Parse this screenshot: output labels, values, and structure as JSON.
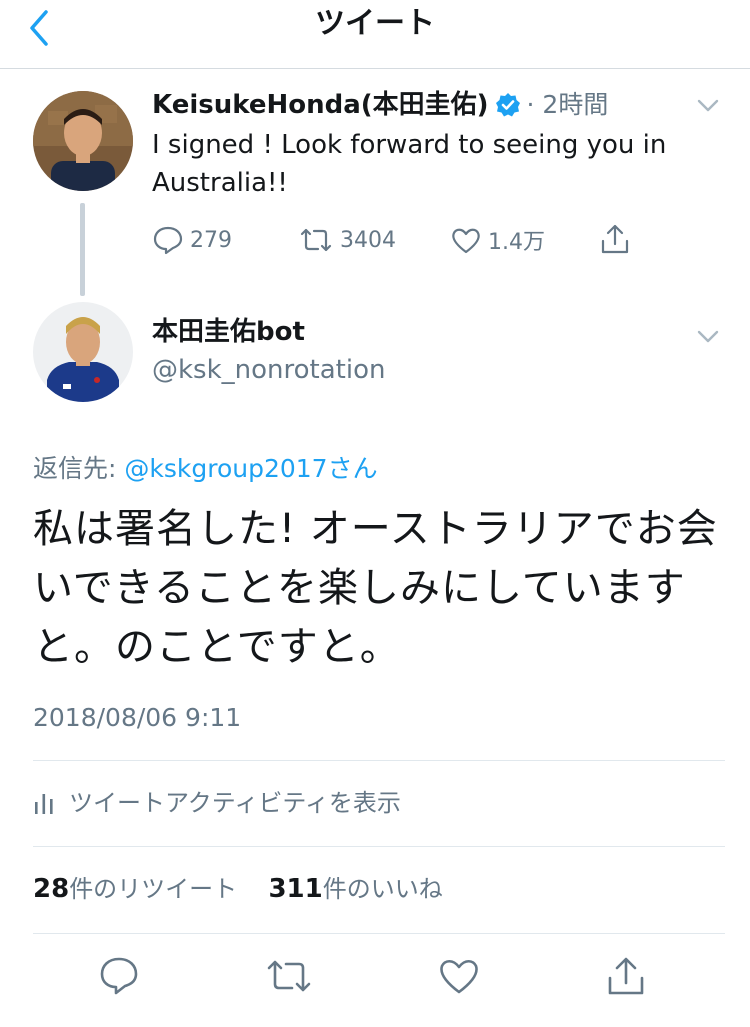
{
  "header": {
    "title": "ツイート"
  },
  "tweet1": {
    "display_name": "KeisukeHonda(本田圭佑)",
    "time": "· 2時間",
    "text": "I signed ! Look forward to seeing you in Australia!!",
    "reply_count": "279",
    "retweet_count": "3404",
    "like_count": "1.4万"
  },
  "tweet2": {
    "display_name": "本田圭佑bot",
    "handle": "@ksk_nonrotation",
    "reply_label": "返信先: ",
    "reply_to": "@kskgroup2017さん",
    "text": "私は署名した! オーストラリアでお会いできることを楽しみにしていますと。のことですと。",
    "timestamp": "2018/08/06 9:11",
    "activity_label": "ツイートアクティビティを表示",
    "retweet_count": "28",
    "retweet_label": "件のリツイート",
    "like_count": "311",
    "like_label": "件のいいね"
  },
  "colors": {
    "accent": "#1da1f2",
    "text": "#14171a",
    "secondary": "#657786",
    "divider": "#e1e8ed"
  },
  "icons": [
    "back-chevron-icon",
    "verified-badge-icon",
    "chevron-down-icon",
    "reply-icon",
    "retweet-icon",
    "like-icon",
    "share-icon",
    "bar-chart-icon"
  ]
}
